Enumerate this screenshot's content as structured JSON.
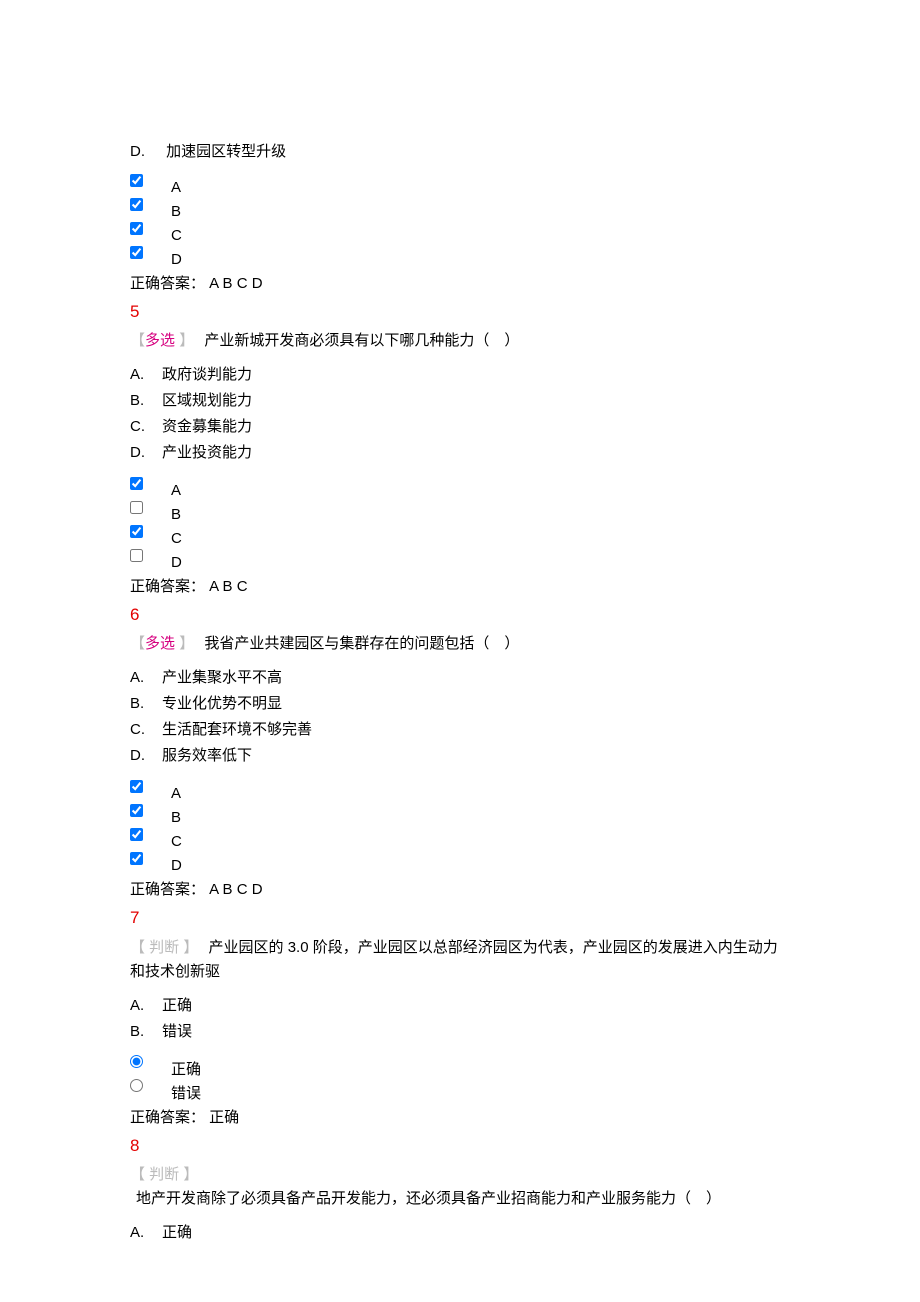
{
  "q4_tail": {
    "optD_prefix": "D.",
    "optD": "加速园区转型升级",
    "checks": [
      {
        "label": "A",
        "checked": true
      },
      {
        "label": "B",
        "checked": true
      },
      {
        "label": "C",
        "checked": true
      },
      {
        "label": "D",
        "checked": true
      }
    ],
    "answer_label": "正确答案：",
    "answer_value": " A B C D"
  },
  "q5": {
    "num": "5",
    "bracket_open": "【",
    "qtype": "多选 ",
    "bracket_close": "】",
    "qtext": " 产业新城开发商必须具有以下哪几种能力（　）",
    "opts": [
      {
        "prefix": "A.",
        "text": "政府谈判能力"
      },
      {
        "prefix": "B.",
        "text": "区域规划能力"
      },
      {
        "prefix": "C.",
        "text": "资金募集能力"
      },
      {
        "prefix": "D.",
        "text": "产业投资能力"
      }
    ],
    "checks": [
      {
        "label": "A",
        "checked": true
      },
      {
        "label": "B",
        "checked": false
      },
      {
        "label": "C",
        "checked": true
      },
      {
        "label": "D",
        "checked": false
      }
    ],
    "answer_label": "正确答案：",
    "answer_value": " A B C"
  },
  "q6": {
    "num": "6",
    "bracket_open": "【",
    "qtype": "多选 ",
    "bracket_close": "】",
    "qtext": " 我省产业共建园区与集群存在的问题包括（　）",
    "opts": [
      {
        "prefix": "A.",
        "text": "产业集聚水平不高"
      },
      {
        "prefix": "B.",
        "text": "专业化优势不明显"
      },
      {
        "prefix": "C.",
        "text": "生活配套环境不够完善"
      },
      {
        "prefix": "D.",
        "text": "服务效率低下"
      }
    ],
    "checks": [
      {
        "label": "A",
        "checked": true
      },
      {
        "label": "B",
        "checked": true
      },
      {
        "label": "C",
        "checked": true
      },
      {
        "label": "D",
        "checked": true
      }
    ],
    "answer_label": "正确答案：",
    "answer_value": " A B C D"
  },
  "q7": {
    "num": "7",
    "bracket_open": "【 ",
    "qtype": "判断 ",
    "bracket_close": "】",
    "qtext": " 产业园区的 3.0 阶段，产业园区以总部经济园区为代表，产业园区的发展进入内生动力和技术创新驱",
    "opts": [
      {
        "prefix": "A.",
        "text": "正确"
      },
      {
        "prefix": "B.",
        "text": "错误"
      }
    ],
    "radios": [
      {
        "label": "正确",
        "checked": true
      },
      {
        "label": "错误",
        "checked": false
      }
    ],
    "answer_label": "正确答案：",
    "answer_value": " 正确"
  },
  "q8": {
    "num": "8",
    "bracket_open": "【 ",
    "qtype": "判断 ",
    "bracket_close": "】",
    "qtext": " 地产开发商除了必须具备产品开发能力，还必须具备产业招商能力和产业服务能力（　）",
    "opts": [
      {
        "prefix": "A.",
        "text": "正确"
      }
    ]
  }
}
